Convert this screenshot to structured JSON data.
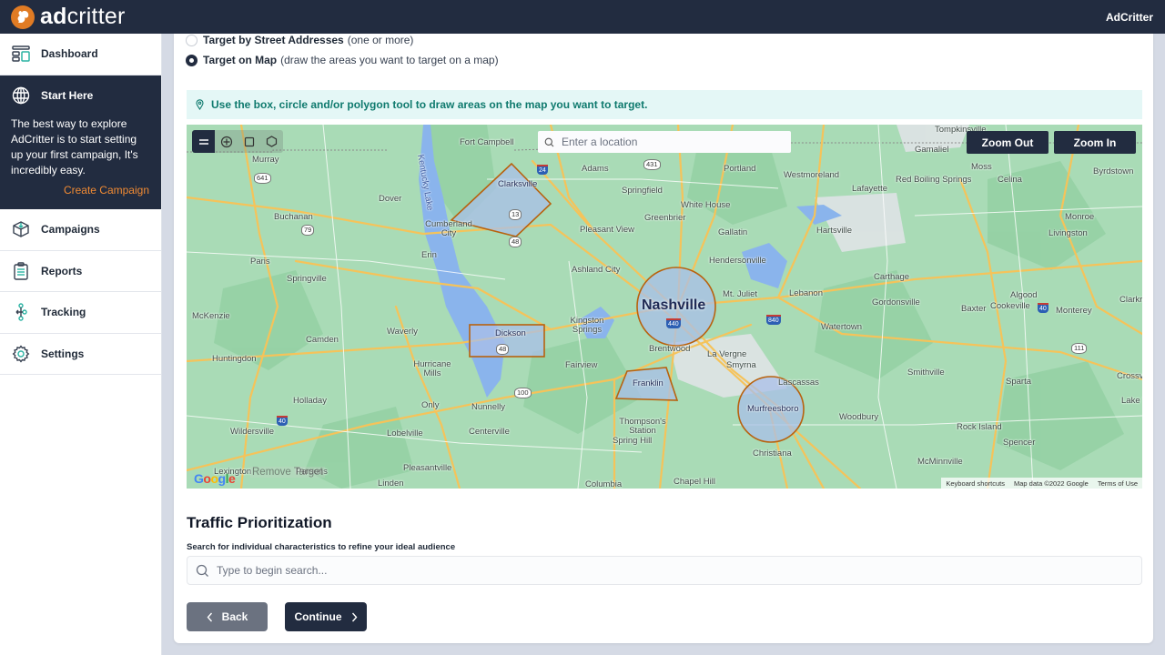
{
  "header": {
    "brand_bold": "ad",
    "brand_light": "critter",
    "user_label": "AdCritter"
  },
  "sidebar": {
    "items": [
      {
        "label": "Dashboard",
        "icon": "dashboard-icon"
      },
      {
        "label": "Start Here",
        "icon": "globe-icon"
      },
      {
        "label": "Campaigns",
        "icon": "box-icon"
      },
      {
        "label": "Reports",
        "icon": "clipboard-icon"
      },
      {
        "label": "Tracking",
        "icon": "tracking-nodes-icon"
      },
      {
        "label": "Settings",
        "icon": "gear-icon"
      }
    ],
    "start_here": {
      "text": "The best way to explore AdCritter is to start setting up your first campaign, It's incredibly easy.",
      "link_label": "Create Campaign"
    },
    "accent_color": "#f08a33"
  },
  "targeting": {
    "options": [
      {
        "label": "Target by Street Addresses",
        "desc": "(one or more)",
        "selected": false
      },
      {
        "label": "Target on Map",
        "desc": "(draw the areas you want to target on a map)",
        "selected": true
      }
    ],
    "info": "Use the box, circle and/or polygon tool to draw areas on the map you want to target."
  },
  "map": {
    "search_placeholder": "Enter a location",
    "zoom_out_label": "Zoom Out",
    "zoom_in_label": "Zoom In",
    "tools": [
      "menu-tool",
      "circle-tool",
      "box-tool",
      "polygon-tool"
    ],
    "remove_target_label": "Remove Target",
    "google_label": "Google",
    "attribution": [
      "Keyboard shortcuts",
      "Map data ©2022 Google",
      "Terms of Use"
    ],
    "target_areas": [
      {
        "type": "polygon",
        "label": "Clarksville"
      },
      {
        "type": "box",
        "label": "Dickson"
      },
      {
        "type": "circle",
        "label": "Nashville"
      },
      {
        "type": "polygon",
        "label": "Franklin"
      },
      {
        "type": "circle",
        "label": "Murfreesboro"
      }
    ],
    "places": [
      "Murray",
      "Fort Campbell",
      "Tompkinsville",
      "Gamaliel",
      "Adams",
      "Portland",
      "Westmoreland",
      "Moss",
      "Byrdstown",
      "Celina",
      "Red Boiling Springs",
      "Lafayette",
      "Dover",
      "Springfield",
      "White House",
      "Greenbrier",
      "Buchanan",
      "Cumberland City",
      "Pleasant View",
      "Gallatin",
      "Hartsville",
      "Monroe",
      "Livingston",
      "Paris",
      "Erin",
      "Springville",
      "Ashland City",
      "Hendersonville",
      "Carthage",
      "Algood",
      "Mt. Juliet",
      "Lebanon",
      "Gordonsville",
      "Baxter",
      "Cookeville",
      "Monterey",
      "Clarkrange",
      "McKenzie",
      "Camden",
      "Waverly",
      "Kingston Springs",
      "Watertown",
      "Huntingdon",
      "Brentwood",
      "La Vergne",
      "Smyrna",
      "Hurricane Mills",
      "Fairview",
      "Smithville",
      "Sparta",
      "Crossville",
      "Lascassas",
      "Holladay",
      "Only",
      "Nunnelly",
      "Lake Tansi",
      "Woodbury",
      "Wildersville",
      "Lobelville",
      "Centerville",
      "Thompson's Station",
      "Rock Island",
      "Spring Hill",
      "Spencer",
      "Christiana",
      "Pleasantville",
      "Lexington",
      "Parsons",
      "Linden",
      "Columbia",
      "Chapel Hill",
      "McMinnville",
      "Kentucky Lake"
    ]
  },
  "traffic": {
    "title": "Traffic Prioritization",
    "subtitle": "Search for individual characteristics to refine your ideal audience",
    "search_placeholder": "Type to begin search..."
  },
  "actions": {
    "back_label": "Back",
    "continue_label": "Continue"
  }
}
